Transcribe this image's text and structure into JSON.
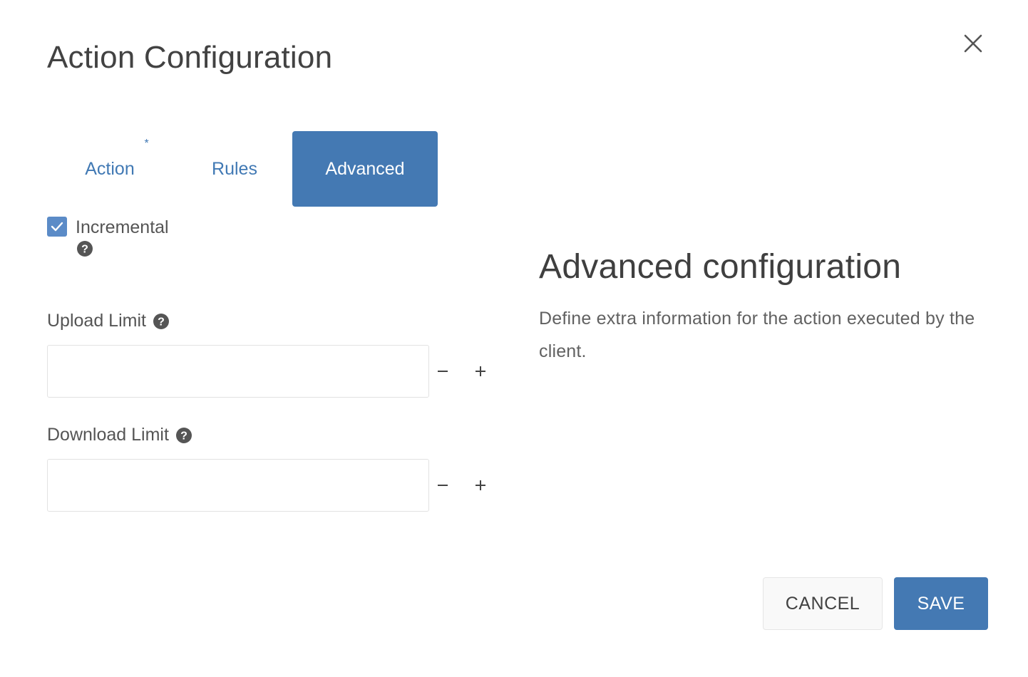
{
  "dialog": {
    "title": "Action Configuration",
    "close_icon": "close-icon"
  },
  "tabs": [
    {
      "label": "Action",
      "required": true,
      "active": false
    },
    {
      "label": "Rules",
      "active": false
    },
    {
      "label": "Advanced",
      "active": true
    }
  ],
  "required_marker": "*",
  "form": {
    "incremental": {
      "label": "Incremental",
      "checked": true,
      "help_icon": "help-circle-icon"
    },
    "upload_limit": {
      "label": "Upload Limit",
      "value": "",
      "placeholder": "",
      "help_icon": "help-circle-icon"
    },
    "download_limit": {
      "label": "Download Limit",
      "value": "",
      "placeholder": "",
      "help_icon": "help-circle-icon"
    },
    "stepper_icons": [
      "minus-icon",
      "plus-icon"
    ]
  },
  "side_panel": {
    "heading": "Advanced configuration",
    "description": "Define extra information for the action executed by the client."
  },
  "footer": {
    "cancel_label": "CANCEL",
    "save_label": "SAVE"
  },
  "colors": {
    "accent": "#4479b3",
    "tab_text": "#4179b4",
    "checkbox": "#5b8bc7",
    "text": "#424242"
  }
}
